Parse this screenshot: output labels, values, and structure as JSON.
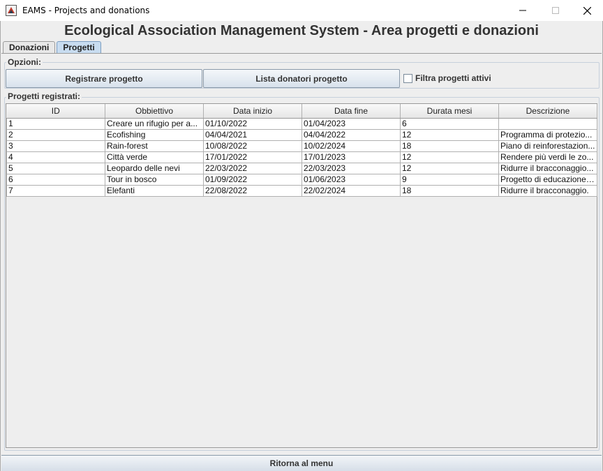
{
  "window": {
    "title": "EAMS - Projects and donations",
    "minimize": "—",
    "maximize": "☐",
    "close": "✕"
  },
  "header": {
    "title": "Ecological Association Management System - Area progetti e donazioni"
  },
  "tabs": [
    {
      "label": "Donazioni",
      "active": false
    },
    {
      "label": "Progetti",
      "active": true
    }
  ],
  "options": {
    "label": "Opzioni:",
    "register_button": "Registrare progetto",
    "donors_button": "Lista donatori progetto",
    "filter_checkbox": {
      "label": "Filtra progetti attivi",
      "checked": false
    }
  },
  "projects": {
    "label": "Progetti registrati:",
    "columns": [
      "ID",
      "Obbiettivo",
      "Data inizio",
      "Data fine",
      "Durata mesi",
      "Descrizione"
    ],
    "rows": [
      [
        "1",
        "Creare un rifugio per a...",
        "01/10/2022",
        "01/04/2023",
        "6",
        ""
      ],
      [
        "2",
        "Ecofishing",
        "04/04/2021",
        "04/04/2022",
        "12",
        "Programma di protezio..."
      ],
      [
        "3",
        "Rain-forest",
        "10/08/2022",
        "10/02/2024",
        "18",
        "Piano di reinforestazion..."
      ],
      [
        "4",
        "Città verde",
        "17/01/2022",
        "17/01/2023",
        "12",
        "Rendere più verdi le zo..."
      ],
      [
        "5",
        "Leopardo delle nevi",
        "22/03/2022",
        "22/03/2023",
        "12",
        "Ridurre il bracconaggio..."
      ],
      [
        "6",
        "Tour in bosco",
        "01/09/2022",
        "01/06/2023",
        "9",
        "Progetto di educazione ..."
      ],
      [
        "7",
        "Elefanti",
        "22/08/2022",
        "22/02/2024",
        "18",
        "Ridurre il bracconaggio."
      ]
    ]
  },
  "footer": {
    "back_button": "Ritorna al menu"
  }
}
